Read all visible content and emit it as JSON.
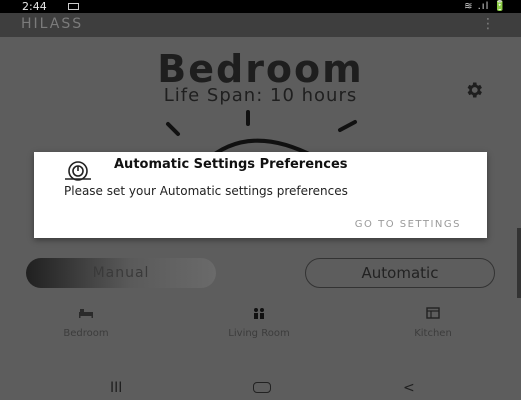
{
  "status_bar": {
    "time": "2:44",
    "icons": "≋ .ıl 🔋"
  },
  "app_bar": {
    "title": "HILASS",
    "menu_icon": "⋮"
  },
  "main": {
    "room_title": "Bedroom",
    "life_span": "Life Span: 10 hours"
  },
  "dialog": {
    "title": "Automatic Settings Preferences",
    "message": "Please set your Automatic settings preferences",
    "action": "GO TO SETTINGS"
  },
  "mode_buttons": {
    "manual": "Manual",
    "automatic": "Automatic"
  },
  "tabs": [
    {
      "label": "Bedroom",
      "icon": "bed-icon"
    },
    {
      "label": "Living Room",
      "icon": "people-icon"
    },
    {
      "label": "Kitchen",
      "icon": "kitchen-icon"
    }
  ],
  "nav": {
    "recents": "III",
    "back": "<"
  }
}
